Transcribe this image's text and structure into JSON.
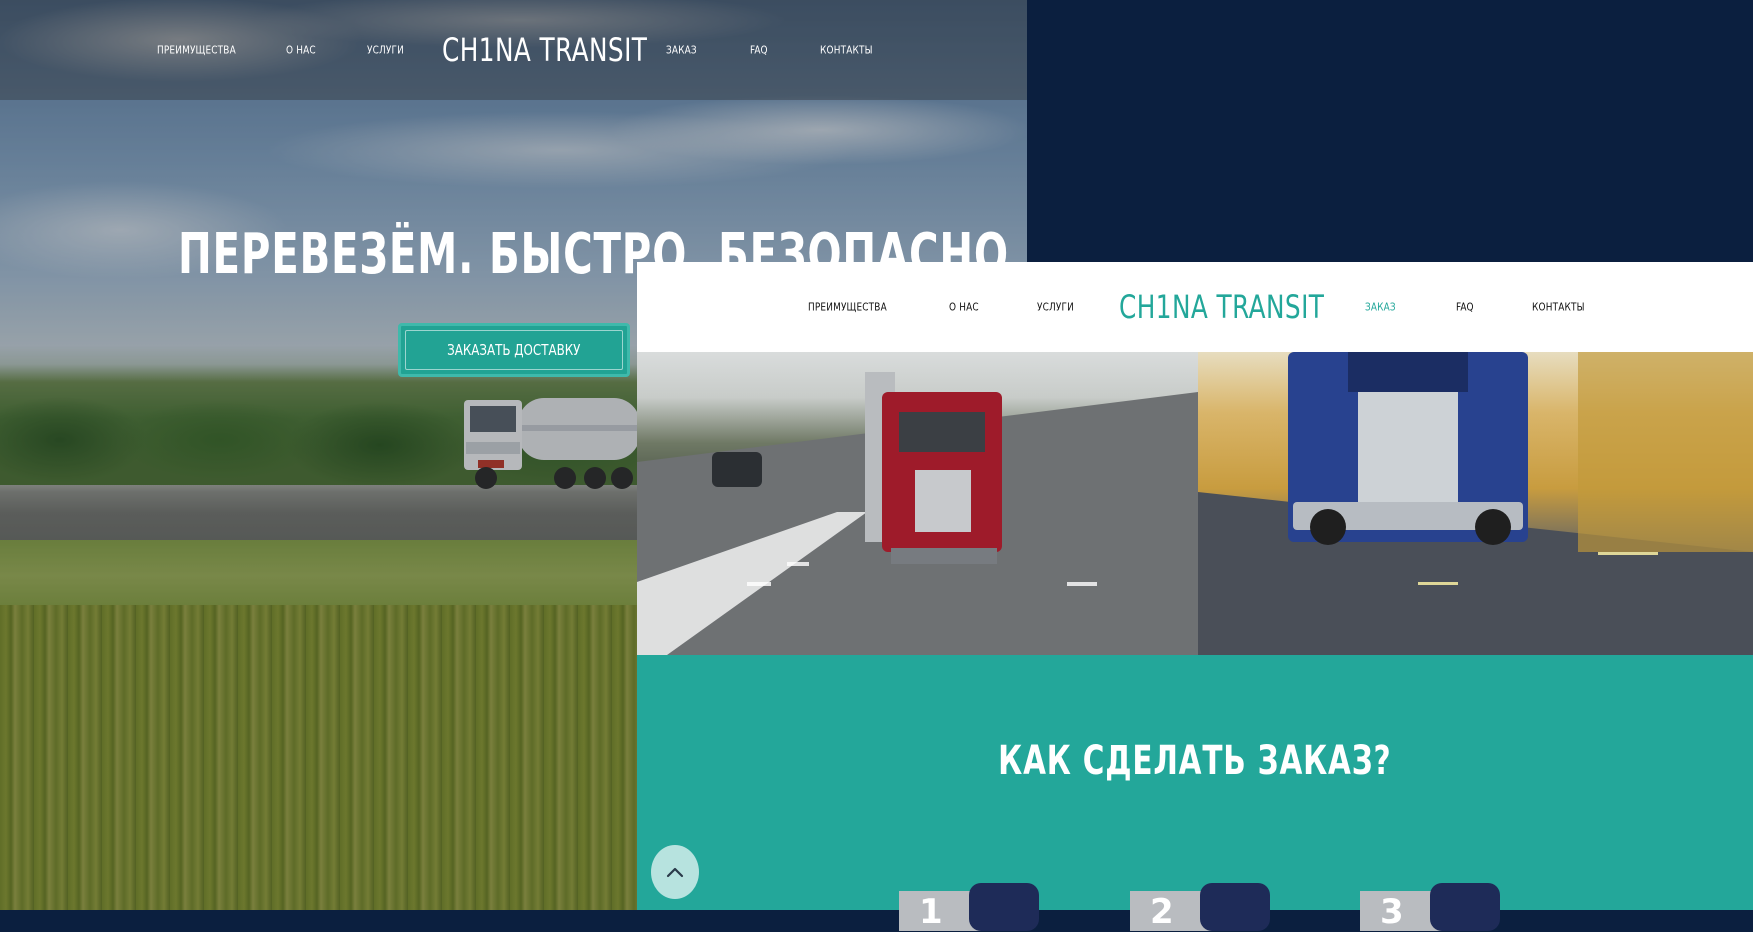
{
  "background_page": {
    "nav": {
      "items": [
        "ПРЕИМУЩЕСТВА",
        "О НАС",
        "УСЛУГИ",
        "ЗАКАЗ",
        "FAQ",
        "КОНТАКТЫ"
      ],
      "logo": "CH1NA TRANSIT"
    },
    "hero": {
      "title": "ПЕРЕВЕЗЁМ. БЫСТРО. БЕЗОПАСНО",
      "button": "ЗАКАЗАТЬ ДОСТАВКУ"
    }
  },
  "front_page": {
    "nav": {
      "items": [
        "ПРЕИМУЩЕСТВА",
        "О НАС",
        "УСЛУГИ",
        "ЗАКАЗ",
        "FAQ",
        "КОНТАКТЫ"
      ],
      "logo": "CH1NA TRANSIT",
      "active_item": "ЗАКАЗ"
    },
    "how_to_order": {
      "title": "КАК СДЕЛАТЬ ЗАКАЗ?",
      "steps": [
        "1",
        "2",
        "3"
      ]
    }
  },
  "icons": {
    "scroll_top": "chevron-up-icon"
  },
  "colors": {
    "accent": "#23a79a",
    "dark_bg": "#0b1f3f",
    "header_bg": "#ffffff",
    "scroll_button_bg": "#b7e3df"
  }
}
